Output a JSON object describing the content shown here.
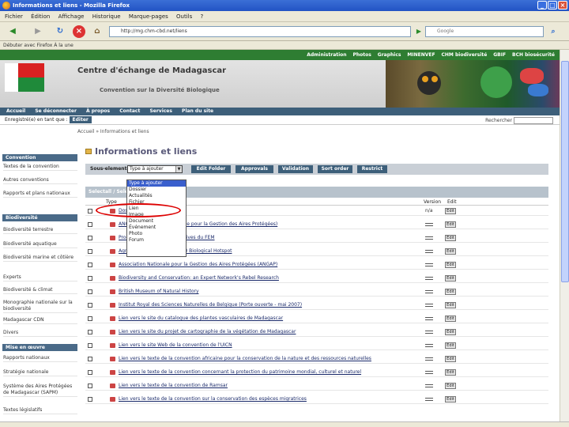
{
  "window": {
    "title": "Informations et liens - Mozilla Firefox"
  },
  "menu": {
    "items": [
      "Fichier",
      "Édition",
      "Affichage",
      "Historique",
      "Marque-pages",
      "Outils",
      "?"
    ]
  },
  "navigation": {
    "url": "http://mg.chm-cbd.net/liens",
    "search_placeholder": "Google"
  },
  "bookmarks": {
    "label": "Débuter avec Firefox  À la une"
  },
  "topnav": {
    "items": [
      "Administration",
      "Photos",
      "Graphics",
      "MINENVEF",
      "CHM biodiversité",
      "GBIF",
      "BCH biosécurité"
    ]
  },
  "banner": {
    "title": "Centre d'échange de Madagascar",
    "subtitle": "Convention sur la Diversité Biologique"
  },
  "mainnav": {
    "items": [
      "Accueil",
      "Se déconnecter",
      "À propos",
      "Contact",
      "Services",
      "Plan du site"
    ]
  },
  "login": {
    "text": "Enregistré(e) en tant que :",
    "button": "Editer",
    "search_label": "Rechercher"
  },
  "breadcrumb": "Accueil » Informations et liens",
  "sidebar": {
    "sections": [
      {
        "title": "Convention",
        "items": [
          "Textes de la convention",
          "Autres conventions",
          "Rapports et plans nationaux"
        ]
      },
      {
        "title": "Biodiversité",
        "items": [
          "Biodiversité terrestre",
          "Biodiversité aquatique",
          "Biodiversité marine et côtière",
          "Experts",
          "Biodiversité & climat",
          "Monographie nationale sur la biodiversité",
          "Madagascar CDN",
          "Divers"
        ]
      },
      {
        "title": "Mise en œuvre",
        "items": [
          "Rapports nationaux",
          "Stratégie nationale",
          "Système des Aires Protégées de Madagascar (SAPM)",
          "Textes législatifs"
        ]
      }
    ]
  },
  "page": {
    "title": "Informations et liens"
  },
  "toolbar": {
    "sub_label": "Sous-elements:",
    "add_select": "Type à ajouter",
    "buttons": [
      "Edit Folder",
      "Approvals",
      "Validation",
      "Sort order",
      "Restrict"
    ]
  },
  "dropdown": {
    "options": [
      "Type à ajouter",
      "Dossier",
      "Actualités",
      "Fichier",
      "Lien",
      "Image",
      "Document",
      "Événement",
      "Photo",
      "Forum"
    ]
  },
  "list": {
    "select_all": "Selectall / Select",
    "col_type": "Type",
    "col_size": "Version",
    "col_edit": "Edit",
    "rows": [
      "Dossier",
      "ANGAP (Association Nationale pour la Gestion des Aires Protégées)",
      "Programme de Petites Initiatives du FEM",
      "Agro (GOUJ / SBF Sanctuaire) Biological Hotspot",
      "Association Nationale pour la Gestion des Aires Protégées (ANGAP)",
      "Biodiversity and Conservation: an Expert Network's Rebel Research",
      "British Museum of Natural History",
      "Institut Royal des Sciences Naturelles de Belgique (Porte ouverte - mai 2007)",
      "Lien vers le site du catalogue des plantes vasculaires de Madagascar",
      "Lien vers le site du projet de cartographie de la végétation de Madagascar",
      "Lien vers le site Web de la convention de l'UICN",
      "Lien vers le texte de la convention africaine pour la conservation de la nature et des ressources naturelles",
      "Lien vers le texte de la convention concernant la protection du patrimoine mondial, culturel et naturel",
      "Lien vers le texte de la convention de Ramsar",
      "Lien vers le texte de la convention sur la conservation des espèces migratrices"
    ],
    "size_label": "n/a",
    "edit_label": "Edit"
  }
}
